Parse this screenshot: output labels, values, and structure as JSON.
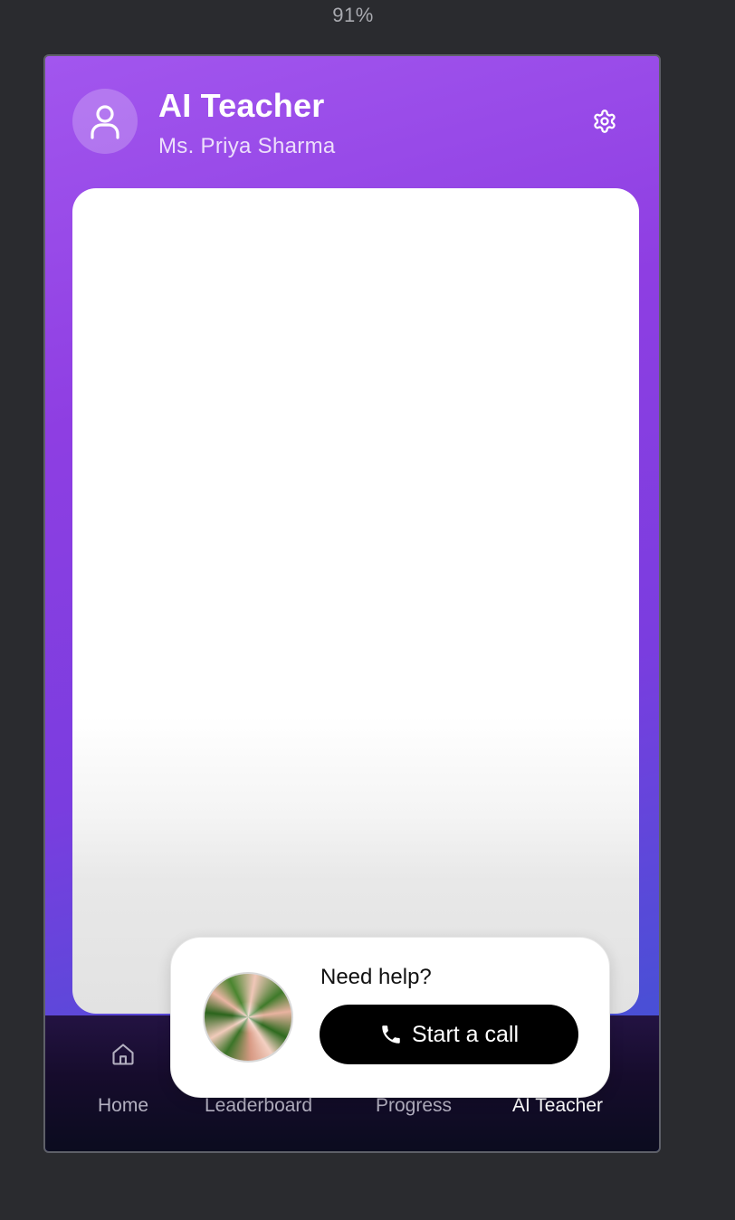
{
  "browser": {
    "zoom_level": "91%"
  },
  "header": {
    "title": "AI Teacher",
    "teacher_name": "Ms. Priya Sharma",
    "avatar_icon": "user-icon",
    "settings_icon": "gear-icon"
  },
  "nav": {
    "items": [
      {
        "label": "Home",
        "icon": "home-icon",
        "active": false
      },
      {
        "label": "Leaderboard",
        "icon": "",
        "active": false
      },
      {
        "label": "Progress",
        "icon": "",
        "active": false
      },
      {
        "label": "AI Teacher",
        "icon": "",
        "active": true
      }
    ]
  },
  "help_widget": {
    "prompt": "Need help?",
    "call_label": "Start a call",
    "call_icon": "phone-icon"
  },
  "colors": {
    "accent_purple": "#8e3ee2",
    "accent_blue": "#3c55cf",
    "nav_background": "#160c2c",
    "call_button": "#000000"
  }
}
